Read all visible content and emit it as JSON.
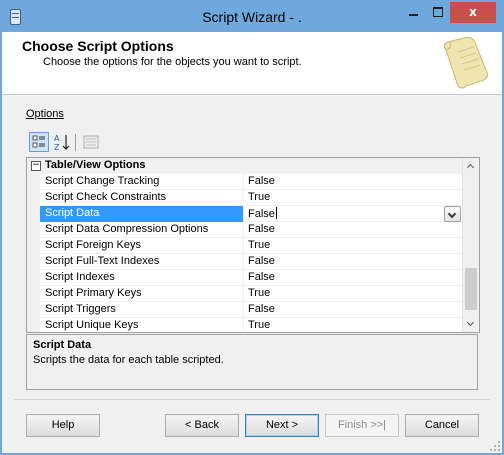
{
  "window": {
    "title": "Script Wizard - .",
    "title_bar_color": "#6fa8dc",
    "close_button_color": "#c7504a",
    "controls": {
      "close_label": "x"
    }
  },
  "header": {
    "title": "Choose Script Options",
    "subtitle": "Choose the options for the objects you want to script.",
    "icon": "scroll-icon"
  },
  "options": {
    "label": "Options",
    "toolbar": [
      {
        "name": "categorized-icon",
        "active": true
      },
      {
        "name": "alphabetical-icon",
        "active": false
      },
      {
        "name": "property-pages-icon",
        "active": false
      }
    ],
    "category": {
      "label": "Table/View Options",
      "toggle": "⊟"
    },
    "properties": [
      {
        "name": "Script Change Tracking",
        "value": "False"
      },
      {
        "name": "Script Check Constraints",
        "value": "True"
      },
      {
        "name": "Script Data",
        "value": "False",
        "selected": true
      },
      {
        "name": "Script Data Compression Options",
        "value": "False"
      },
      {
        "name": "Script Foreign Keys",
        "value": "True"
      },
      {
        "name": "Script Full-Text Indexes",
        "value": "False"
      },
      {
        "name": "Script Indexes",
        "value": "False"
      },
      {
        "name": "Script Primary Keys",
        "value": "True"
      },
      {
        "name": "Script Triggers",
        "value": "False"
      },
      {
        "name": "Script Unique Keys",
        "value": "True"
      }
    ],
    "selection_color": "#3399ff"
  },
  "description": {
    "title": "Script Data",
    "text": "Scripts the data for each table scripted."
  },
  "buttons": {
    "help": "Help",
    "back": "< Back",
    "next": "Next >",
    "finish": "Finish >>|",
    "cancel": "Cancel"
  }
}
